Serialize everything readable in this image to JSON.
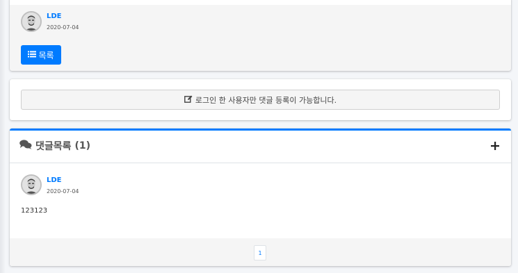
{
  "post": {
    "author": "LDE",
    "date": "2020-07-04",
    "list_button_label": "목록"
  },
  "comment_form": {
    "login_notice": "로그인 한 사용자만 댓글 등록이 가능합니다."
  },
  "comments": {
    "title": "댓글목록",
    "count": "(1)",
    "items": [
      {
        "author": "LDE",
        "date": "2020-07-04",
        "text": "123123"
      }
    ]
  },
  "pagination": {
    "pages": [
      "1"
    ]
  },
  "colors": {
    "primary": "#007bff",
    "background": "#f4f6f9"
  }
}
